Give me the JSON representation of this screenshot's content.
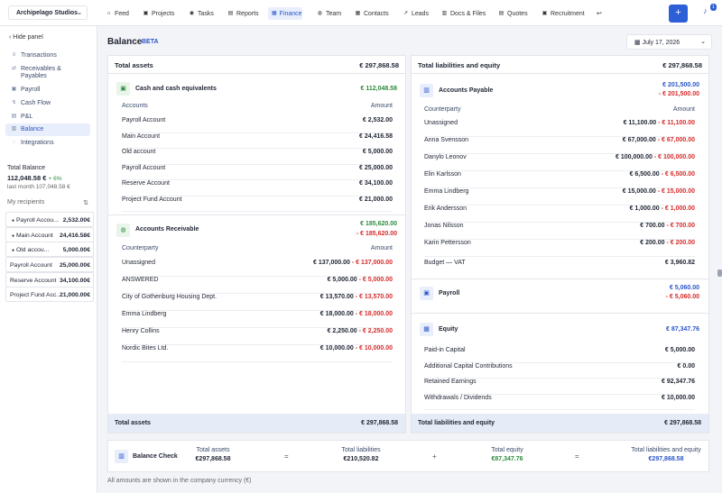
{
  "company": "Archipelago Studios",
  "nav": [
    {
      "label": "Feed",
      "icon": "home-icon",
      "g": "⌂"
    },
    {
      "label": "Projects",
      "icon": "folder-icon",
      "g": "▣"
    },
    {
      "label": "Tasks",
      "icon": "check-circle-icon",
      "g": "◉"
    },
    {
      "label": "Reports",
      "icon": "report-icon",
      "g": "▤"
    },
    {
      "label": "Finance",
      "icon": "finance-icon",
      "g": "▦"
    },
    {
      "label": "Team",
      "icon": "team-icon",
      "g": "◍"
    },
    {
      "label": "Contacts",
      "icon": "contacts-icon",
      "g": "▦"
    },
    {
      "label": "Leads",
      "icon": "leads-icon",
      "g": "↗"
    },
    {
      "label": "Docs & Files",
      "icon": "docs-icon",
      "g": "▥"
    },
    {
      "label": "Quotes",
      "icon": "quote-icon",
      "g": "▤"
    },
    {
      "label": "Recruitment",
      "icon": "recruitment-icon",
      "g": "▣"
    }
  ],
  "notif_count": "1",
  "sidebar": {
    "hide": "Hide panel",
    "items": [
      "Transactions",
      "Receivables & Payables",
      "Payroll",
      "Cash Flow",
      "P&L",
      "Balance",
      "Integrations"
    ],
    "total_label": "Total Balance",
    "total_value": "112,048.58 €",
    "total_pct": "+ 6%",
    "last_month": "last month 107,048.58 €",
    "recipients_label": "My recipients",
    "recipients": [
      {
        "name": "Payroll Accou...",
        "value": "2,532.00€"
      },
      {
        "name": "Main Account",
        "value": "24,416.58€"
      },
      {
        "name": "Old accou...",
        "value": "5,000.00€"
      },
      {
        "name": "Payroll Account",
        "value": "25,000.00€"
      },
      {
        "name": "Reserve Account",
        "value": "34,100.00€"
      },
      {
        "name": "Project Fund Acc...",
        "value": "21,000.00€"
      }
    ]
  },
  "title": "Balance",
  "beta": "BETA",
  "date": "July 17, 2026",
  "assets": {
    "label": "Total assets",
    "value": "€ 297,868.58",
    "cash": {
      "title": "Cash and cash equivalents",
      "value": "€ 112,048.58",
      "col1": "Accounts",
      "col2": "Amount",
      "rows": [
        [
          "Payroll Account",
          "€ 2,532.00"
        ],
        [
          "Main Account",
          "€ 24,416.58"
        ],
        [
          "Old account",
          "€ 5,000.00"
        ],
        [
          "Payroll Account",
          "€ 25,000.00"
        ],
        [
          "Reserve Account",
          "€ 34,100.00"
        ],
        [
          "Project Fund Account",
          "€ 21,000.00"
        ]
      ]
    },
    "recv": {
      "title": "Accounts Receivable",
      "value": "€ 185,620.00",
      "minus": "- € 185,620.00",
      "col1": "Counterparty",
      "col2": "Amount",
      "rows": [
        [
          "Unassigned",
          "€ 137,000.00",
          "- € 137,000.00"
        ],
        [
          "ANSWERED",
          "€ 5,000.00",
          "- € 5,000.00"
        ],
        [
          "City of Gothenburg Housing Dept.",
          "€ 13,570.00",
          "- € 13,570.00"
        ],
        [
          "Emma Lindberg",
          "€ 18,000.00",
          "- € 18,000.00"
        ],
        [
          "Henry Collins",
          "€ 2,250.00",
          "- € 2,250.00"
        ],
        [
          "Nordic Bites Ltd.",
          "€ 10,000.00",
          "- € 10,000.00"
        ]
      ]
    },
    "footer_label": "Total assets",
    "footer_value": "€ 297,868.58"
  },
  "liab": {
    "label": "Total liabilities and equity",
    "value": "€ 297,868.58",
    "ap": {
      "title": "Accounts Payable",
      "value": "€ 201,500.00",
      "minus": "- € 201,500.00",
      "col1": "Counterparty",
      "col2": "Amount",
      "rows": [
        [
          "Unassigned",
          "€ 11,100.00",
          "- € 11,100.00"
        ],
        [
          "Anna Svensson",
          "€ 67,000.00",
          "- € 67,000.00"
        ],
        [
          "Danylo Leonov",
          "€ 100,000.00",
          "- € 100,000.00"
        ],
        [
          "Elin Karlsson",
          "€ 6,500.00",
          "- € 6,500.00"
        ],
        [
          "Emma Lindberg",
          "€ 15,000.00",
          "- € 15,000.00"
        ],
        [
          "Erik Andersson",
          "€ 1,000.00",
          "- € 1,000.00"
        ],
        [
          "Jonas Nilsson",
          "€ 700.00",
          "- € 700.00"
        ],
        [
          "Karin Pettersson",
          "€ 200.00",
          "- € 200.00"
        ],
        [
          "Budget — VAT",
          "€ 3,960.82",
          ""
        ]
      ]
    },
    "payroll": {
      "title": "Payroll",
      "value": "€ 5,060.00",
      "minus": "- € 5,060.00"
    },
    "equity": {
      "title": "Equity",
      "value": "€ 87,347.76",
      "rows": [
        [
          "Paid-in Capital",
          "€ 5,000.00"
        ],
        [
          "Additional Capital Contributions",
          "€ 0.00"
        ],
        [
          "Retained Earnings",
          "€ 92,347.76"
        ],
        [
          "Withdrawals / Dividends",
          "€ 10,000.00"
        ]
      ]
    },
    "footer_label": "Total liabilities and equity",
    "footer_value": "€ 297,868.58"
  },
  "check": {
    "title": "Balance Check",
    "cols": [
      {
        "label": "Total assets",
        "value": "€297,868.58"
      },
      {
        "label": "Total liabilities",
        "value": "€210,520.82"
      },
      {
        "label": "Total equity",
        "value": "€87,347.76"
      },
      {
        "label": "Total liabilities and equity",
        "value": "€297,868.58"
      }
    ],
    "ops": [
      "=",
      "+",
      "="
    ]
  },
  "note": "All amounts are shown in the company currency (€)",
  "colors": {
    "accent": "#2d5fd6",
    "green": "#2e8b3d",
    "red": "#d62b2b"
  }
}
